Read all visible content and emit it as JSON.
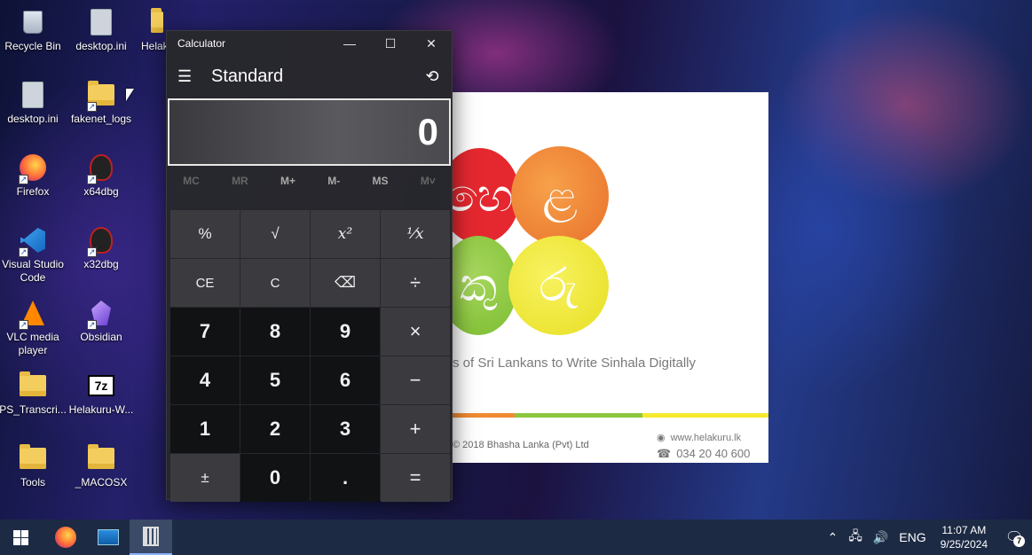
{
  "desktop": {
    "icons": [
      {
        "label": "Recycle Bin",
        "icon": "recycle-bin-icon"
      },
      {
        "label": "desktop.ini",
        "icon": "settings-file-icon"
      },
      {
        "label": "Helak",
        "icon": "folder-icon"
      },
      {
        "label": "desktop.ini",
        "icon": "settings-file-icon"
      },
      {
        "label": "fakenet_logs",
        "icon": "folder-icon"
      },
      {
        "label": "Firefox",
        "icon": "firefox-icon"
      },
      {
        "label": "x64dbg",
        "icon": "x64dbg-icon"
      },
      {
        "label": "Visual Studio Code",
        "icon": "vscode-icon"
      },
      {
        "label": "x32dbg",
        "icon": "x32dbg-icon"
      },
      {
        "label": "VLC media player",
        "icon": "vlc-icon"
      },
      {
        "label": "Obsidian",
        "icon": "obsidian-icon"
      },
      {
        "label": "PS_Transcri...",
        "icon": "folder-icon"
      },
      {
        "label": "Helakuru-W...",
        "icon": "7zip-icon"
      },
      {
        "label": "Tools",
        "icon": "folder-icon"
      },
      {
        "label": "_MACOSX",
        "icon": "folder-icon"
      }
    ]
  },
  "calculator": {
    "window_title": "Calculator",
    "mode": "Standard",
    "display": "0",
    "memory": [
      "MC",
      "MR",
      "M+",
      "M-",
      "MS",
      "M˅"
    ],
    "keys": [
      "%",
      "√",
      "x²",
      "¹⁄x",
      "CE",
      "C",
      "⌫",
      "÷",
      "7",
      "8",
      "9",
      "×",
      "4",
      "5",
      "6",
      "−",
      "1",
      "2",
      "3",
      "+",
      "±",
      "0",
      ".",
      "="
    ]
  },
  "splash": {
    "letters": [
      "හෙ",
      "ළ",
      "කු",
      "රු"
    ],
    "tagline": "s of Sri Lankans to Write Sinhala Digitally",
    "copyright": "© 2018 Bhasha Lanka (Pvt) Ltd",
    "website": "www.helakuru.lk",
    "phone": "034 20 40 600",
    "colors": [
      "#e52a2f",
      "#f08a33",
      "#8cc63f",
      "#f5ea2e"
    ]
  },
  "taskbar": {
    "apps": [
      "start-icon",
      "firefox-icon",
      "task-manager-icon",
      "calculator-icon"
    ],
    "language": "ENG",
    "time": "11:07 AM",
    "date": "9/25/2024",
    "notifications": "7"
  }
}
